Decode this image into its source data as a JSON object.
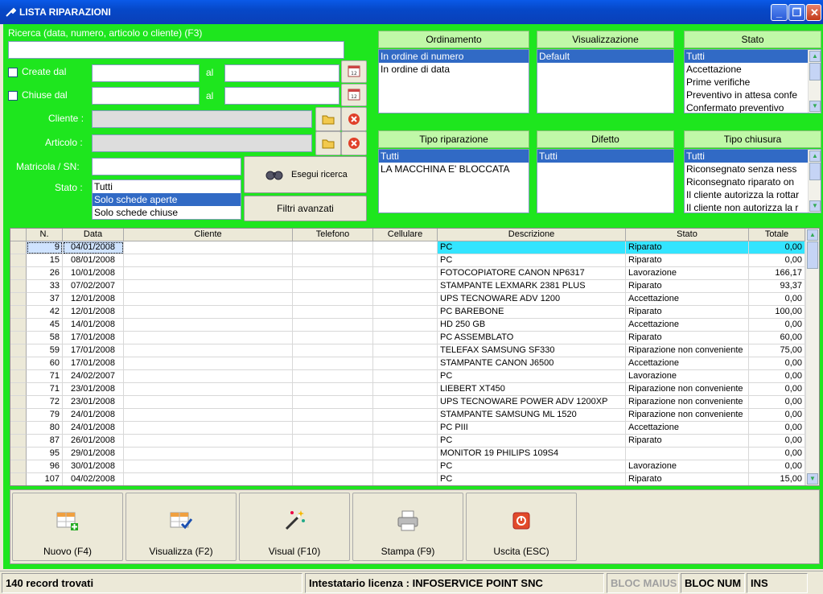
{
  "window": {
    "title": "LISTA RIPARAZIONI"
  },
  "colors": {
    "accent_green": "#1ee61e",
    "selection_blue": "#316ac5",
    "header_green": "#c0f8a8",
    "highlight_cyan": "#33e4ff"
  },
  "search": {
    "label": "Ricerca (data, numero, articolo o cliente) (F3)",
    "value": "",
    "create_label": "Create dal",
    "create_from": "",
    "create_al": "al",
    "create_to": "",
    "closed_label": "Chiuse dal",
    "closed_from": "",
    "closed_al": "al",
    "closed_to": "",
    "cliente_label": "Cliente :",
    "cliente_value": "",
    "articolo_label": "Articolo :",
    "articolo_value": "",
    "matricola_label": "Matricola / SN:",
    "matricola_value": "",
    "stato_label": "Stato :",
    "stato_options": [
      "Tutti",
      "Solo schede aperte",
      "Solo schede chiuse"
    ],
    "stato_selected": 1,
    "search_button": "Esegui ricerca",
    "advanced_button": "Filtri avanzati"
  },
  "panels": [
    {
      "title": "Ordinamento",
      "items": [
        "In ordine di numero",
        "In ordine di data"
      ],
      "selected": 0
    },
    {
      "title": "Visualizzazione",
      "items": [
        "Default"
      ],
      "selected": 0
    },
    {
      "title": "Stato",
      "items": [
        "Tutti",
        "Accettazione",
        "Prime verifiche",
        "Preventivo in attesa confe",
        "Confermato preventivo"
      ],
      "selected": 0
    },
    {
      "title": "Tipo riparazione",
      "items": [
        "Tutti",
        "LA MACCHINA E' BLOCCATA"
      ],
      "selected": 0
    },
    {
      "title": "Difetto",
      "items": [
        "Tutti"
      ],
      "selected": 0
    },
    {
      "title": "Tipo chiusura",
      "items": [
        "Tutti",
        "Riconsegnato senza ness",
        "Riconsegnato riparato on",
        "Il cliente autorizza la rottar",
        "Il cliente non autorizza la r"
      ],
      "selected": 0
    }
  ],
  "grid": {
    "columns": [
      "N.",
      "Data",
      "Cliente",
      "Telefono",
      "Cellulare",
      "Descrizione",
      "Stato",
      "Totale"
    ],
    "rows": [
      [
        "9",
        "04/01/2008",
        "",
        "",
        "",
        "PC",
        "Riparato",
        "0,00"
      ],
      [
        "15",
        "08/01/2008",
        "",
        "",
        "",
        "PC",
        "Riparato",
        "0,00"
      ],
      [
        "26",
        "10/01/2008",
        "",
        "",
        "",
        "FOTOCOPIATORE CANON NP6317",
        "Lavorazione",
        "166,17"
      ],
      [
        "33",
        "07/02/2007",
        "",
        "",
        "",
        "STAMPANTE LEXMARK 2381 PLUS",
        "Riparato",
        "93,37"
      ],
      [
        "37",
        "12/01/2008",
        "",
        "",
        "",
        "UPS TECNOWARE ADV 1200",
        "Accettazione",
        "0,00"
      ],
      [
        "42",
        "12/01/2008",
        "",
        "",
        "",
        "PC BAREBONE",
        "Riparato",
        "100,00"
      ],
      [
        "45",
        "14/01/2008",
        "",
        "",
        "",
        "HD 250 GB",
        "Accettazione",
        "0,00"
      ],
      [
        "58",
        "17/01/2008",
        "",
        "",
        "",
        "PC ASSEMBLATO",
        "Riparato",
        "60,00"
      ],
      [
        "59",
        "17/01/2008",
        "",
        "",
        "",
        "TELEFAX SAMSUNG SF330",
        "Riparazione non conveniente",
        "75,00"
      ],
      [
        "60",
        "17/01/2008",
        "",
        "",
        "",
        "STAMPANTE CANON J6500",
        "Accettazione",
        "0,00"
      ],
      [
        "71",
        "24/02/2007",
        "",
        "",
        "",
        "PC",
        "Lavorazione",
        "0,00"
      ],
      [
        "71",
        "23/01/2008",
        "",
        "",
        "",
        "LIEBERT XT450",
        "Riparazione non conveniente",
        "0,00"
      ],
      [
        "72",
        "23/01/2008",
        "",
        "",
        "",
        "UPS TECNOWARE POWER ADV 1200XP",
        "Riparazione non conveniente",
        "0,00"
      ],
      [
        "79",
        "24/01/2008",
        "",
        "",
        "",
        "STAMPANTE SAMSUNG ML 1520",
        "Riparazione non conveniente",
        "0,00"
      ],
      [
        "80",
        "24/01/2008",
        "",
        "",
        "",
        "PC PIII",
        "Accettazione",
        "0,00"
      ],
      [
        "87",
        "26/01/2008",
        "",
        "",
        "",
        "PC",
        "Riparato",
        "0,00"
      ],
      [
        "95",
        "29/01/2008",
        "",
        "",
        "",
        "MONITOR 19 PHILIPS 109S4",
        "",
        "0,00"
      ],
      [
        "96",
        "30/01/2008",
        "",
        "",
        "",
        "PC",
        "Lavorazione",
        "0,00"
      ],
      [
        "107",
        "04/02/2008",
        "",
        "",
        "",
        "PC",
        "Riparato",
        "15,00"
      ]
    ]
  },
  "toolbar": {
    "new": "Nuovo (F4)",
    "view": "Visualizza (F2)",
    "visual": "Visual (F10)",
    "print": "Stampa (F9)",
    "exit": "Uscita (ESC)"
  },
  "statusbar": {
    "records": "140 record trovati",
    "license": "Intestatario licenza : INFOSERVICE POINT SNC",
    "caps": "BLOC MAIUS",
    "num": "BLOC NUM",
    "ins": "INS"
  }
}
